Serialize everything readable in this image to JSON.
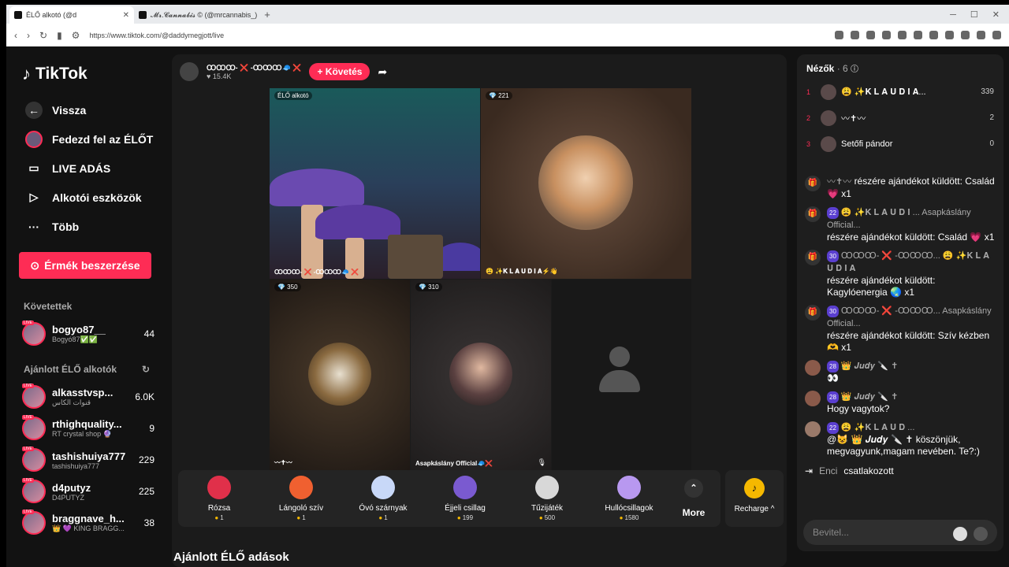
{
  "browser": {
    "tabs": [
      {
        "title": "ÉLŐ alkotó (@d",
        "active": true
      },
      {
        "title": "𝓜𝓻.𝓒𝓪𝓷𝓷𝓪𝓫𝓲𝓼 © (@mrcannabis_)",
        "active": false
      }
    ],
    "url": "https://www.tiktok.com/@daddymegjott/live"
  },
  "sidebar": {
    "logo": "TikTok",
    "nav": [
      {
        "label": "Vissza",
        "icon": "back-arrow-icon"
      },
      {
        "label": "Fedezd fel az ÉLŐT",
        "icon": "avatar-icon"
      },
      {
        "label": "LIVE ADÁS",
        "icon": "camera-icon"
      },
      {
        "label": "Alkotói eszközök",
        "icon": "play-icon"
      },
      {
        "label": "Több",
        "icon": "more-icon"
      }
    ],
    "coins_button": "Érmék beszerzése",
    "followed_label": "Követettek",
    "followed": [
      {
        "name": "bogyo87__",
        "sub": "Bogyó87✅✅",
        "count": "44"
      }
    ],
    "recommended_label": "Ajánlott ÉLŐ alkotók",
    "recommended": [
      {
        "name": "alkasstvsp...",
        "sub": "قنوات الكاس",
        "count": "6.0K"
      },
      {
        "name": "rthighquality...",
        "sub": "RT crystal shop 🔮",
        "count": "9"
      },
      {
        "name": "tashishuiya777",
        "sub": "tashishuiya777",
        "count": "229"
      },
      {
        "name": "d4putyz",
        "sub": "D4PUTYZ",
        "count": "225"
      },
      {
        "name": "braggnave_h...",
        "sub": "👑 💜 KING BRAGG...",
        "count": "38"
      }
    ]
  },
  "stream": {
    "host_name": "ꝎꝎꝎ- ❌ -ꝎꝎꝎ🧢 ❌",
    "host_likes": "♥ 15.4K",
    "follow_button": "+ Követés",
    "cells": [
      {
        "tag": "ÉLŐ alkotó",
        "name": "ꝎꝎꝎ- ❌ -ꝎꝎꝎ🧢 ❌"
      },
      {
        "tag": "💎 221",
        "name": "😩 ✨𝐊 𝐋 𝐀 𝐔 𝐃 𝐈 𝐀⚡👋"
      },
      {
        "tag": "💎 350",
        "name": "〰✝〰"
      },
      {
        "tag": "💎 310",
        "name": "Asapkáslány Official🧢❌"
      },
      {
        "tag": "",
        "name": ""
      }
    ],
    "gifts": [
      {
        "name": "Rózsa",
        "price": "1",
        "color": "#e0304a"
      },
      {
        "name": "Lángoló szív",
        "price": "1",
        "color": "#f06030"
      },
      {
        "name": "Óvó szárnyak",
        "price": "1",
        "color": "#c8d8f8"
      },
      {
        "name": "Éjjeli csillag",
        "price": "199",
        "color": "#7a5ad0"
      },
      {
        "name": "Tűzijáték",
        "price": "500",
        "color": "#d8d8d8"
      },
      {
        "name": "Hullócsillagok",
        "price": "1580",
        "color": "#b898f0"
      }
    ],
    "more_label": "More",
    "recharge_label": "Recharge ^",
    "below_heading": "Ajánlott ÉLŐ adások"
  },
  "chat": {
    "viewers_title": "Nézők",
    "viewers_count": "· 6",
    "viewers": [
      {
        "rank": "1",
        "name": "😩 ✨𝐊 𝐋 𝐀 𝐔 𝐃 𝐈 𝐀...",
        "count": "339"
      },
      {
        "rank": "2",
        "name": "〰✝〰",
        "count": "2"
      },
      {
        "rank": "3",
        "name": "Setőfi pándor",
        "count": "0"
      }
    ],
    "messages": [
      {
        "badge": "",
        "who": "〰✝〰",
        "text": "részére ajándékot küldött: Család 💗 x1"
      },
      {
        "badge": "22",
        "who": "😩 ✨𝐊 𝐋 𝐀 𝐔 𝐃 𝐈 ... Asapkáslány Official...",
        "text": "részére ajándékot küldött: Család 💗 x1"
      },
      {
        "badge": "30",
        "who": "ꝎꝎꝎ- ❌ -ꝎꝎꝎ... 😩 ✨𝐊 𝐋 𝐀 𝐔 𝐃 𝐈 𝐀",
        "text": "részére ajándékot küldött: Kagylóenergia 🌏 x1"
      },
      {
        "badge": "30",
        "who": "ꝎꝎꝎ- ❌ -ꝎꝎꝎ... Asapkáslány Official...",
        "text": "részére ajándékot küldött: Szív kézben 🫶 x1"
      },
      {
        "badge": "28",
        "who": "👑 𝑱𝒖𝒅𝒚 🔪 ✝",
        "text": "👀"
      },
      {
        "badge": "28",
        "who": "👑 𝑱𝒖𝒅𝒚 🔪 ✝",
        "text": "Hogy vagytok?"
      },
      {
        "badge": "22",
        "who": "😩 ✨𝐊 𝐋 𝐀 𝐔 𝐃 ...",
        "text": "@😺 👑 𝑱𝒖𝒅𝒚 🔪 ✝ köszönjük, megvagyunk,magam nevében. Te?:)"
      }
    ],
    "joined_name": "Enci",
    "joined_text": "csatlakozott",
    "input_placeholder": "Bevitel..."
  }
}
